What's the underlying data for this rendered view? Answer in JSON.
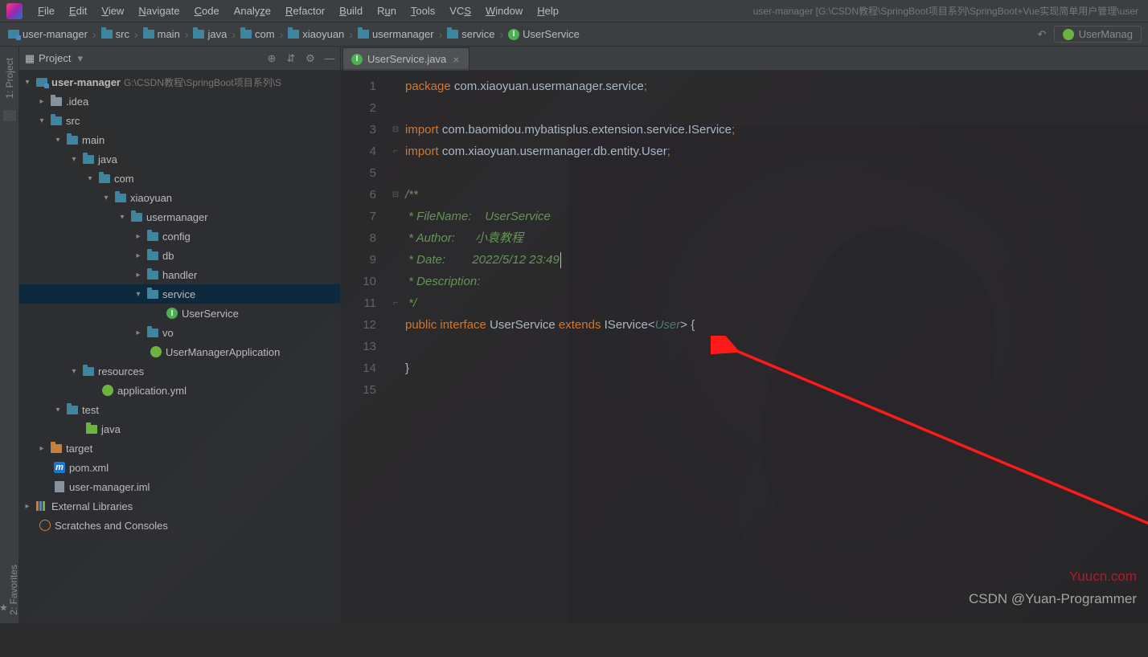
{
  "menubar": {
    "items": [
      "File",
      "Edit",
      "View",
      "Navigate",
      "Code",
      "Analyze",
      "Refactor",
      "Build",
      "Run",
      "Tools",
      "VCS",
      "Window",
      "Help"
    ],
    "projectInfo": "user-manager [G:\\CSDN教程\\SpringBoot项目系列\\SpringBoot+Vue实现简单用户管理\\user"
  },
  "breadcrumb": [
    {
      "icon": "module",
      "label": "user-manager"
    },
    {
      "icon": "folder-blue",
      "label": "src"
    },
    {
      "icon": "folder-blue",
      "label": "main"
    },
    {
      "icon": "folder-blue",
      "label": "java"
    },
    {
      "icon": "folder-blue",
      "label": "com"
    },
    {
      "icon": "folder-blue",
      "label": "xiaoyuan"
    },
    {
      "icon": "folder-blue",
      "label": "usermanager"
    },
    {
      "icon": "folder-blue",
      "label": "service"
    },
    {
      "icon": "iface",
      "label": "UserService"
    }
  ],
  "runConfig": "UserManag",
  "panel": {
    "title": "Project"
  },
  "leftStrip": {
    "tab1": "1: Project",
    "tab2": "2: Favorites"
  },
  "tree": {
    "root": {
      "label": "user-manager",
      "tail": "G:\\CSDN教程\\SpringBoot项目系列\\S"
    },
    "idea": ".idea",
    "src": "src",
    "main": "main",
    "java": "java",
    "com": "com",
    "xiaoyuan": "xiaoyuan",
    "usermanager": "usermanager",
    "config": "config",
    "db": "db",
    "handler": "handler",
    "service": "service",
    "userService": "UserService",
    "vo": "vo",
    "app": "UserManagerApplication",
    "resources": "resources",
    "appyml": "application.yml",
    "test": "test",
    "javaTest": "java",
    "target": "target",
    "pom": "pom.xml",
    "iml": "user-manager.iml",
    "extLib": "External Libraries",
    "scratch": "Scratches and Consoles"
  },
  "tab": {
    "label": "UserService.java"
  },
  "code": {
    "line1_kw": "package",
    "line1_pkg": " com.xiaoyuan.usermanager.service",
    "line1_sc": ";",
    "line3_kw": "import",
    "line3_pkg": " com.baomidou.mybatisplus.extension.service.IService",
    "line3_sc": ";",
    "line4_kw": "import",
    "line4_pkg": " com.xiaoyuan.usermanager.db.entity.User",
    "line4_sc": ";",
    "line6": "/**",
    "line7": " * FileName:    UserService",
    "line8": " * Author:      小袁教程",
    "line9": " * Date:        2022/5/12 23:49",
    "line10": " * Description:",
    "line11": " */",
    "line12_kw1": "public ",
    "line12_kw2": "interface ",
    "line12_name": "UserService ",
    "line12_kw3": "extends ",
    "line12_ext": "IService",
    "line12_gen": "<",
    "line12_type": "User",
    "line12_genc": "> {",
    "line14": "}",
    "lineNumbers": [
      "1",
      "2",
      "3",
      "4",
      "5",
      "6",
      "7",
      "8",
      "9",
      "10",
      "11",
      "12",
      "13",
      "14",
      "15"
    ]
  },
  "watermark": {
    "site": "Yuucn.com",
    "csdn": "CSDN @Yuan-Programmer"
  }
}
